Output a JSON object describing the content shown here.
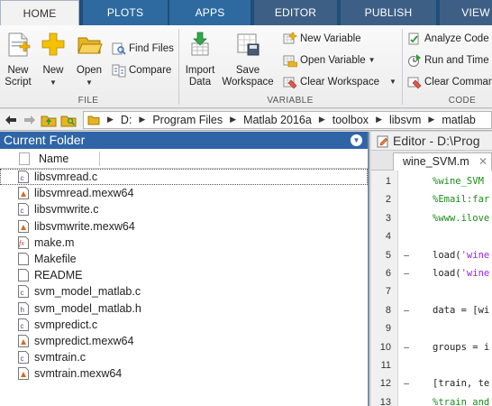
{
  "ribbon": {
    "tabs": [
      "HOME",
      "PLOTS",
      "APPS",
      "EDITOR",
      "PUBLISH",
      "VIEW"
    ],
    "sections": {
      "file": "FILE",
      "variable": "VARIABLE",
      "code": "CODE"
    },
    "buttons": {
      "new_script": [
        "New",
        "Script"
      ],
      "new": "New",
      "open": "Open",
      "find_files": "Find Files",
      "compare": "Compare",
      "import_data": [
        "Import",
        "Data"
      ],
      "save_workspace": [
        "Save",
        "Workspace"
      ],
      "new_variable": "New Variable",
      "open_variable": "Open Variable",
      "clear_workspace": "Clear Workspace",
      "analyze_code": "Analyze Code",
      "run_and_time": "Run and Time",
      "clear_commands": "Clear Commands"
    }
  },
  "address_bar": {
    "path": [
      "D:",
      "Program Files",
      "Matlab 2016a",
      "toolbox",
      "libsvm",
      "matlab"
    ]
  },
  "current_folder": {
    "title": "Current Folder",
    "column_name": "Name",
    "files": [
      {
        "name": "libsvmread.c",
        "icon": "c-file-icon",
        "selected": true
      },
      {
        "name": "libsvmread.mexw64",
        "icon": "mex-file-icon"
      },
      {
        "name": "libsvmwrite.c",
        "icon": "c-file-icon"
      },
      {
        "name": "libsvmwrite.mexw64",
        "icon": "mex-file-icon"
      },
      {
        "name": "make.m",
        "icon": "m-file-icon"
      },
      {
        "name": "Makefile",
        "icon": "blank-file-icon"
      },
      {
        "name": "README",
        "icon": "blank-file-icon"
      },
      {
        "name": "svm_model_matlab.c",
        "icon": "c-file-icon"
      },
      {
        "name": "svm_model_matlab.h",
        "icon": "h-file-icon"
      },
      {
        "name": "svmpredict.c",
        "icon": "c-file-icon"
      },
      {
        "name": "svmpredict.mexw64",
        "icon": "mex-file-icon"
      },
      {
        "name": "svmtrain.c",
        "icon": "c-file-icon"
      },
      {
        "name": "svmtrain.mexw64",
        "icon": "mex-file-icon"
      }
    ]
  },
  "editor": {
    "title": "Editor - D:\\Prog",
    "tab_label": "wine_SVM.m",
    "lines": [
      {
        "n": "1",
        "dash": "",
        "text": "%wine_SVM",
        "kind": "cmt"
      },
      {
        "n": "2",
        "dash": "",
        "text": "%Email:far",
        "kind": "cmt"
      },
      {
        "n": "3",
        "dash": "",
        "text": "%www.ilove",
        "kind": "cmt"
      },
      {
        "n": "4",
        "dash": "",
        "text": "",
        "kind": "plain"
      },
      {
        "n": "5",
        "dash": "–",
        "text": "load('wine",
        "kind": "str"
      },
      {
        "n": "6",
        "dash": "–",
        "text": "load('wine",
        "kind": "str"
      },
      {
        "n": "7",
        "dash": "",
        "text": "",
        "kind": "plain"
      },
      {
        "n": "8",
        "dash": "–",
        "text": "data = [wi",
        "kind": "plain"
      },
      {
        "n": "9",
        "dash": "",
        "text": "",
        "kind": "plain"
      },
      {
        "n": "10",
        "dash": "–",
        "text": "groups = i",
        "kind": "plain"
      },
      {
        "n": "11",
        "dash": "",
        "text": "",
        "kind": "plain"
      },
      {
        "n": "12",
        "dash": "–",
        "text": "[train, te",
        "kind": "plain"
      },
      {
        "n": "13",
        "dash": "",
        "text": "%train and",
        "kind": "cmt"
      }
    ]
  }
}
